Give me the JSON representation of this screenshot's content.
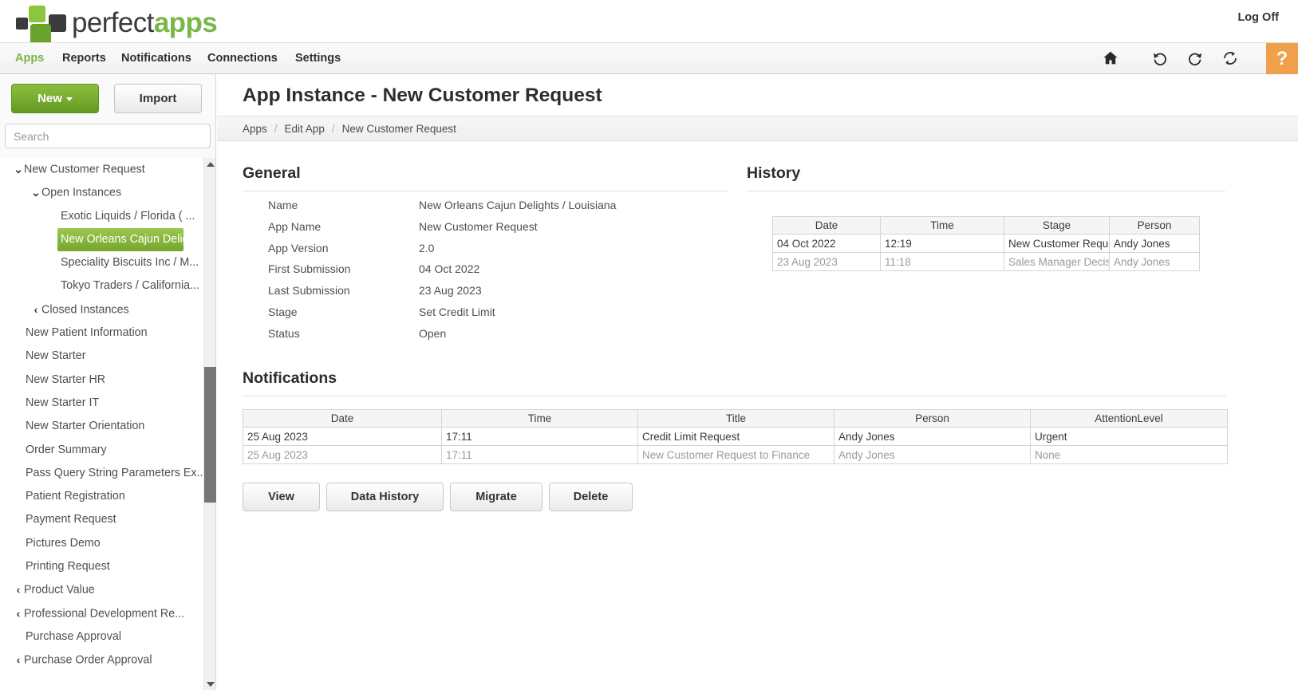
{
  "brand": {
    "name_part1": "perfect",
    "name_part2": "apps",
    "logoff_label": "Log Off",
    "green": "#7ab648",
    "dark": "#3b3b3b"
  },
  "nav": {
    "items": [
      {
        "label": "Apps",
        "active": true
      },
      {
        "label": "Reports",
        "active": false
      },
      {
        "label": "Notifications",
        "active": false
      },
      {
        "label": "Connections",
        "active": false
      },
      {
        "label": "Settings",
        "active": false
      }
    ],
    "icons": [
      "home-icon",
      "undo-icon",
      "redo-icon",
      "refresh-icon"
    ],
    "help_label": "?",
    "help_color": "#f0a04b"
  },
  "sidebar": {
    "new_label": "New",
    "import_label": "Import",
    "search_placeholder": "Search",
    "tree": [
      {
        "label": "New Customer Request",
        "level": "lvl0b",
        "chev": "⌄",
        "selected": false
      },
      {
        "label": "Open Instances",
        "level": "lvl1",
        "chev": "⌄",
        "selected": false
      },
      {
        "label": "Exotic Liquids / Florida ( ...",
        "level": "lvl2",
        "chev": "",
        "selected": false
      },
      {
        "label": "New Orleans Cajun Delig...",
        "level": "lvl2",
        "chev": "",
        "selected": true
      },
      {
        "label": "Speciality Biscuits Inc / M...",
        "level": "lvl2",
        "chev": "",
        "selected": false
      },
      {
        "label": "Tokyo Traders / California...",
        "level": "lvl2",
        "chev": "",
        "selected": false
      },
      {
        "label": "Closed Instances",
        "level": "lvl1",
        "chev": "‹",
        "selected": false
      },
      {
        "label": "New Patient Information",
        "level": "lvl0",
        "chev": "",
        "selected": false
      },
      {
        "label": "New Starter",
        "level": "lvl0",
        "chev": "",
        "selected": false
      },
      {
        "label": "New Starter HR",
        "level": "lvl0",
        "chev": "",
        "selected": false
      },
      {
        "label": "New Starter IT",
        "level": "lvl0",
        "chev": "",
        "selected": false
      },
      {
        "label": "New Starter Orientation",
        "level": "lvl0",
        "chev": "",
        "selected": false
      },
      {
        "label": "Order Summary",
        "level": "lvl0",
        "chev": "",
        "selected": false
      },
      {
        "label": "Pass Query String Parameters Ex...",
        "level": "lvl0",
        "chev": "",
        "selected": false
      },
      {
        "label": "Patient Registration",
        "level": "lvl0",
        "chev": "",
        "selected": false
      },
      {
        "label": "Payment Request",
        "level": "lvl0",
        "chev": "",
        "selected": false
      },
      {
        "label": "Pictures Demo",
        "level": "lvl0",
        "chev": "",
        "selected": false
      },
      {
        "label": "Printing Request",
        "level": "lvl0",
        "chev": "",
        "selected": false
      },
      {
        "label": "Product Value",
        "level": "lvl0b",
        "chev": "‹",
        "selected": false
      },
      {
        "label": "Professional Development Re...",
        "level": "lvl0b",
        "chev": "‹",
        "selected": false
      },
      {
        "label": "Purchase Approval",
        "level": "lvl0",
        "chev": "",
        "selected": false
      },
      {
        "label": "Purchase Order Approval",
        "level": "lvl0b",
        "chev": "‹",
        "selected": false
      }
    ]
  },
  "page": {
    "title": "App Instance - New Customer Request",
    "breadcrumb": [
      "Apps",
      "Edit App",
      "New Customer Request"
    ]
  },
  "general": {
    "title": "General",
    "rows": [
      {
        "label": "Name",
        "value": "New Orleans Cajun Delights / Louisiana"
      },
      {
        "label": "App Name",
        "value": "New Customer Request"
      },
      {
        "label": "App Version",
        "value": "2.0"
      },
      {
        "label": "First Submission",
        "value": "04 Oct 2022"
      },
      {
        "label": "Last Submission",
        "value": "23 Aug 2023"
      },
      {
        "label": "Stage",
        "value": "Set Credit Limit"
      },
      {
        "label": "Status",
        "value": "Open"
      }
    ]
  },
  "history": {
    "title": "History",
    "columns": [
      "Date",
      "Time",
      "Stage",
      "Person"
    ],
    "rows": [
      {
        "cells": [
          "04 Oct 2022",
          "12:19",
          "New Customer Request",
          "Andy Jones"
        ],
        "muted": false
      },
      {
        "cells": [
          "23 Aug 2023",
          "11:18",
          "Sales Manager Decision",
          "Andy Jones"
        ],
        "muted": true
      }
    ]
  },
  "notifications": {
    "title": "Notifications",
    "columns": [
      "Date",
      "Time",
      "Title",
      "Person",
      "AttentionLevel"
    ],
    "rows": [
      {
        "cells": [
          "25 Aug 2023",
          "17:11",
          "Credit Limit Request",
          "Andy Jones",
          "Urgent"
        ],
        "muted": false
      },
      {
        "cells": [
          "25 Aug 2023",
          "17:11",
          "New Customer Request to Finance",
          "Andy Jones",
          "None"
        ],
        "muted": true
      }
    ]
  },
  "actions": {
    "view": "View",
    "data_history": "Data History",
    "migrate": "Migrate",
    "delete": "Delete"
  }
}
